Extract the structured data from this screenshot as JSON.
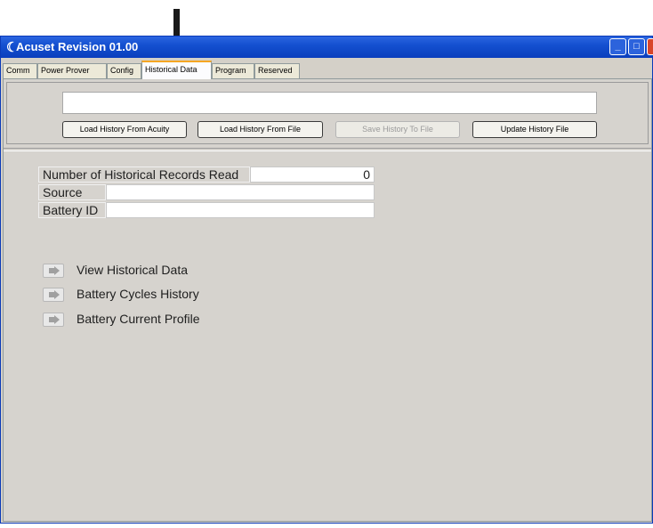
{
  "window": {
    "title": "Acuset Revision 01.00",
    "title_icon": "☾",
    "controls": {
      "minimize": "_",
      "maximize": "□",
      "close": "×"
    }
  },
  "tabs": [
    {
      "label": "Comm"
    },
    {
      "label": "Power Prover"
    },
    {
      "label": "Config"
    },
    {
      "label": "Historical Data",
      "active": true
    },
    {
      "label": "Program"
    },
    {
      "label": "Reserved"
    }
  ],
  "toolbar": {
    "status_text": "",
    "load_acuity": "Load History From Acuity",
    "load_file": "Load History From File",
    "save_file": "Save History To File",
    "update_file": "Update History File"
  },
  "info": {
    "records_label": "Number of Historical Records Read",
    "records_value": "0",
    "source_label": "Source",
    "source_value": "",
    "battery_label": "Battery ID",
    "battery_value": ""
  },
  "links": {
    "view_historical": "View Historical Data",
    "cycles_history": "Battery Cycles History",
    "current_profile": "Battery Current Profile"
  },
  "colors": {
    "titlebar": "#1450d0",
    "active_tab_accent": "#f5a623",
    "panel_bg": "#d6d3ce",
    "annotation_arrow": "#1a1a1a"
  }
}
